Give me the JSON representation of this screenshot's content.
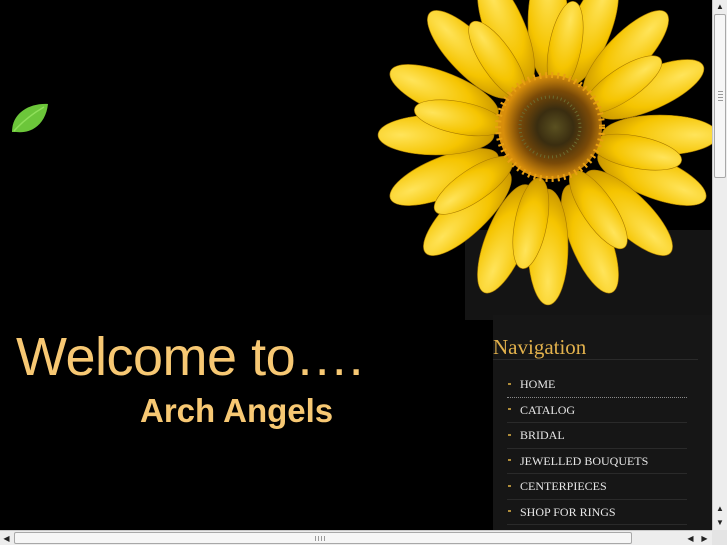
{
  "welcome_text": "Welcome to….",
  "brand_name": "Arch Angels",
  "navigation": {
    "title": "Navigation",
    "items": [
      {
        "label": "HOME"
      },
      {
        "label": "CATALOG"
      },
      {
        "label": "BRIDAL"
      },
      {
        "label": "JEWELLED BOUQUETS"
      },
      {
        "label": "CENTERPIECES"
      },
      {
        "label": "SHOP FOR RINGS"
      }
    ]
  },
  "icons": {
    "logo": "leaf-icon",
    "hero": "sunflower-image",
    "scroll_up": "arrow-up-icon",
    "scroll_down": "arrow-down-icon",
    "scroll_left": "arrow-left-icon",
    "scroll_right": "arrow-right-icon"
  },
  "colors": {
    "background": "#000000",
    "heading": "#f7c873",
    "nav_title": "#e2b14c",
    "nav_text": "#e8e8e8",
    "leaf": "#6cc63a",
    "petal": "#f5c400"
  }
}
